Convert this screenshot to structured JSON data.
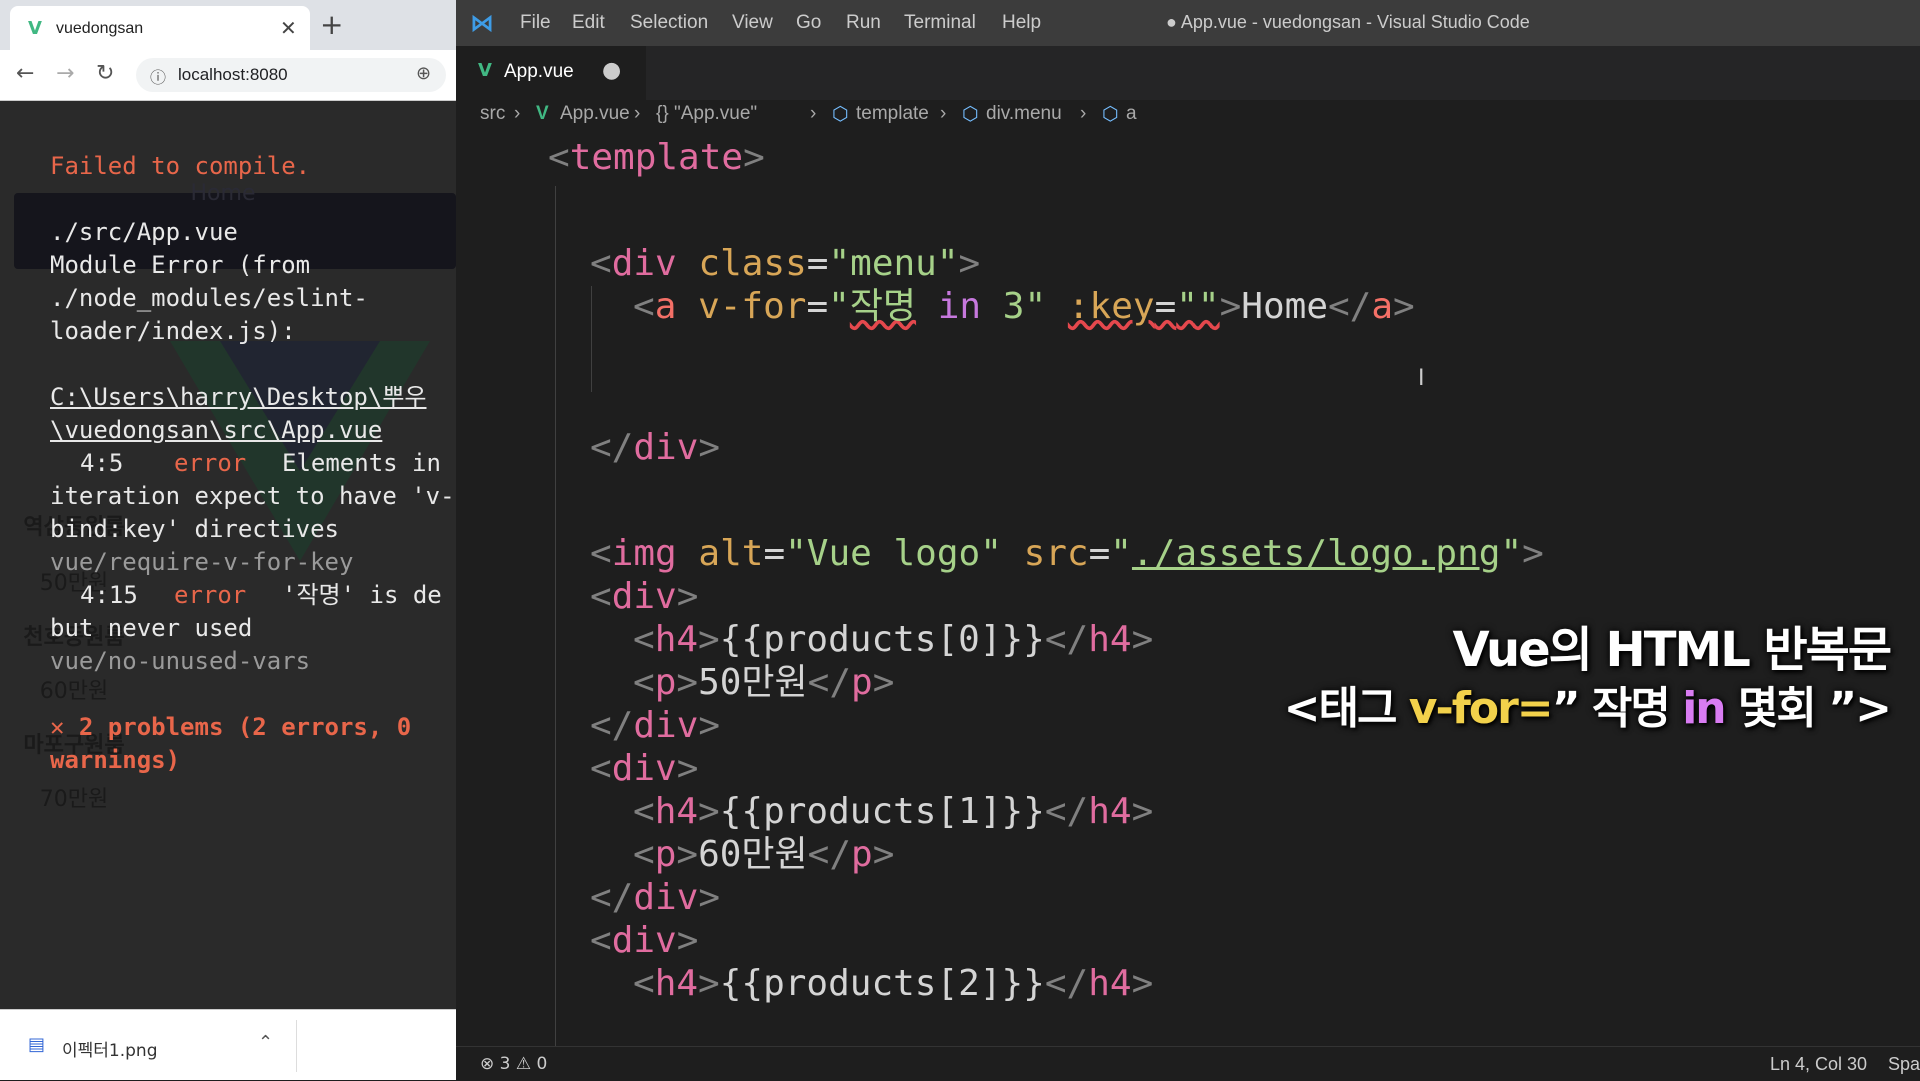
{
  "browser": {
    "tab_title": "vuedongsan",
    "new_tab": "+",
    "close": "✕",
    "url": "localhost:8080",
    "background_page": {
      "nav_link": "Home",
      "items": [
        "역삼동원룸",
        "50만원",
        "천호동원룸",
        "60만원",
        "마포구원룸",
        "70만원"
      ]
    },
    "error": {
      "title": "Failed to compile.",
      "lines": [
        "./src/App.vue",
        "Module Error (from",
        "./node_modules/eslint-",
        "loader/index.js):",
        "C:\\Users\\harry\\Desktop\\뿌우",
        "\\vuedongsan\\src\\App.vue",
        "4:5",
        "error",
        "Elements in",
        "iteration expect to have 'v-",
        "bind:key' directives",
        "vue/require-v-for-key",
        "4:15",
        "error",
        "'작명' is de",
        "but never used",
        "vue/no-unused-vars",
        "✕ 2 problems (2 errors, 0",
        "warnings)"
      ]
    },
    "download": {
      "filename": "이펙터1.png"
    }
  },
  "vscode": {
    "menus": [
      "File",
      "Edit",
      "Selection",
      "View",
      "Go",
      "Run",
      "Terminal",
      "Help"
    ],
    "window_title": "● App.vue - vuedongsan - Visual Studio Code",
    "tab": {
      "label": "App.vue",
      "dirty": "●"
    },
    "breadcrumbs": [
      "src",
      "App.vue",
      "{} \"App.vue\"",
      "template",
      "div.menu",
      "a"
    ],
    "code": {
      "template": "template",
      "div": "div",
      "class_attr": "class",
      "menu_val": "\"menu\"",
      "a": "a",
      "vfor": "v-for",
      "vfor_q1": "\"",
      "vfor_name": "작명",
      "in": "in",
      "three": "3",
      "vfor_q2": "\"",
      "key_attr": ":key",
      "key_val": "\"\"",
      "home": "Home",
      "img": "img",
      "alt_attr": "alt",
      "alt_val": "\"Vue logo\"",
      "src_attr": "src",
      "src_q": "\"",
      "src_path": "./assets/logo.png",
      "h4": "h4",
      "p": "p",
      "prod0": "{{products[0]}}",
      "prod1": "{{products[1]}}",
      "prod2": "{{products[2]}}",
      "price0": "50만원",
      "price1": "60만원"
    },
    "caption": {
      "line1": "Vue의 HTML 반복문",
      "line2_a": "<태그 ",
      "line2_b": "v-for=",
      "line2_c": "” 작명 ",
      "line2_d": "in",
      "line2_e": " 몇회 ”>"
    },
    "status": {
      "problems": "⊗ 3 ⚠ 0",
      "position": "Ln 4, Col 30",
      "spaces": "Spa"
    }
  },
  "colors": {
    "vue_green": "#41b883",
    "error_red": "#e8664a",
    "tag_pink": "#e06c9f"
  }
}
